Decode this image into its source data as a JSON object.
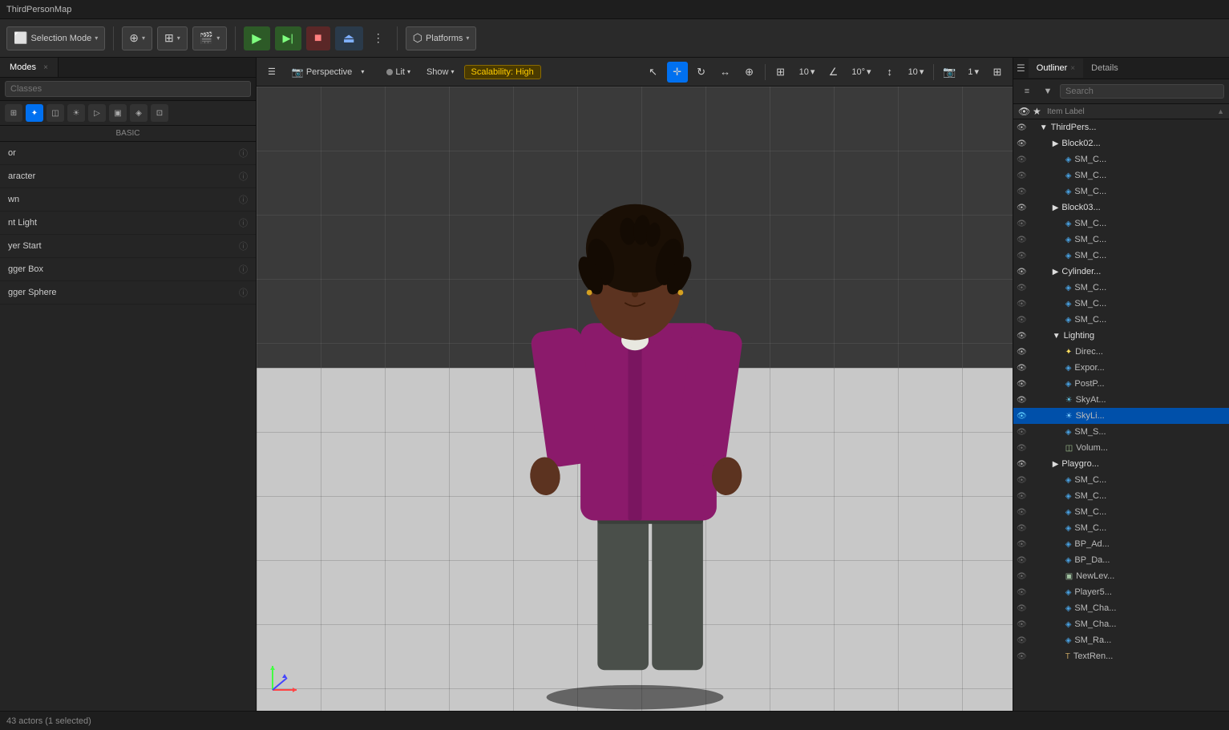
{
  "app": {
    "title": "ThirdPersonMap",
    "window_close": "×"
  },
  "toolbar": {
    "selection_mode_label": "Selection Mode",
    "chevron": "▾",
    "play_icon": "▶",
    "play_from_icon": "▶|",
    "stop_icon": "■",
    "eject_icon": "⏏",
    "more_icon": "⋮",
    "platforms_icon": "⬡",
    "platforms_label": "Platforms"
  },
  "viewport": {
    "menu_icon": "☰",
    "perspective_label": "Perspective",
    "lit_label": "Lit",
    "show_label": "Show",
    "scalability_label": "Scalability: High",
    "camera_icon": "◎",
    "snap_icon": "+",
    "rotate_icon": "↻",
    "scale_icon": "↔",
    "grid_icon": "⊞",
    "grid_value": "10",
    "angle_icon": "∠",
    "angle_value": "10°",
    "scale_value": "10",
    "camera_speed": "1",
    "layout_icon": "⊞"
  },
  "left_panel": {
    "tab_label": "Modes",
    "tab_close": "×",
    "search_placeholder": "Classes",
    "basic_label": "BASIC",
    "items": [
      {
        "name": "Actor",
        "partial": "or"
      },
      {
        "name": "Character",
        "partial": "aracter"
      },
      {
        "name": "Pawn",
        "partial": "wn"
      },
      {
        "name": "Point Light",
        "partial": "nt Light"
      },
      {
        "name": "Player Start",
        "partial": "yer Start"
      },
      {
        "name": "Trigger Box",
        "partial": "gger Box"
      },
      {
        "name": "Trigger Sphere",
        "partial": "gger Sphere"
      }
    ]
  },
  "right_panel": {
    "outliner_tab_label": "Outliner",
    "details_tab_label": "Details",
    "tab_close": "×",
    "search_placeholder": "Search",
    "column_label": "Item Label",
    "items": [
      {
        "indent": 0,
        "type": "folder",
        "name": "ThirdPers...",
        "icon": "▼"
      },
      {
        "indent": 1,
        "type": "folder",
        "name": "Block02...",
        "icon": "▶"
      },
      {
        "indent": 2,
        "type": "mesh",
        "name": "SM_C...",
        "icon": "◈"
      },
      {
        "indent": 2,
        "type": "mesh",
        "name": "SM_C...",
        "icon": "◈"
      },
      {
        "indent": 2,
        "type": "mesh",
        "name": "SM_C...",
        "icon": "◈"
      },
      {
        "indent": 1,
        "type": "folder",
        "name": "Block03...",
        "icon": "▶"
      },
      {
        "indent": 2,
        "type": "mesh",
        "name": "SM_C...",
        "icon": "◈"
      },
      {
        "indent": 2,
        "type": "mesh",
        "name": "SM_C...",
        "icon": "◈"
      },
      {
        "indent": 2,
        "type": "mesh",
        "name": "SM_C...",
        "icon": "◈"
      },
      {
        "indent": 1,
        "type": "folder",
        "name": "Cylinder...",
        "icon": "▶"
      },
      {
        "indent": 2,
        "type": "mesh",
        "name": "SM_C...",
        "icon": "◈"
      },
      {
        "indent": 2,
        "type": "mesh",
        "name": "SM_C...",
        "icon": "◈"
      },
      {
        "indent": 2,
        "type": "mesh",
        "name": "SM_C...",
        "icon": "◈"
      },
      {
        "indent": 1,
        "type": "folder",
        "name": "Lighting",
        "icon": "▼"
      },
      {
        "indent": 2,
        "type": "light",
        "name": "Direc...",
        "icon": "✦"
      },
      {
        "indent": 2,
        "type": "mesh",
        "name": "Expor...",
        "icon": "◈"
      },
      {
        "indent": 2,
        "type": "mesh",
        "name": "PostP...",
        "icon": "◈"
      },
      {
        "indent": 2,
        "type": "light",
        "name": "SkyAt...",
        "icon": "☀"
      },
      {
        "indent": 2,
        "type": "light",
        "name": "SkyLi...",
        "icon": "☀",
        "selected": true
      },
      {
        "indent": 2,
        "type": "mesh",
        "name": "SM_S...",
        "icon": "◈"
      },
      {
        "indent": 2,
        "type": "volume",
        "name": "Volum...",
        "icon": "◫"
      },
      {
        "indent": 1,
        "type": "folder",
        "name": "Playgro...",
        "icon": "▶"
      },
      {
        "indent": 2,
        "type": "mesh",
        "name": "SM_C...",
        "icon": "◈"
      },
      {
        "indent": 2,
        "type": "mesh",
        "name": "SM_C...",
        "icon": "◈"
      },
      {
        "indent": 2,
        "type": "mesh",
        "name": "SM_C...",
        "icon": "◈"
      },
      {
        "indent": 2,
        "type": "mesh",
        "name": "SM_C...",
        "icon": "◈"
      },
      {
        "indent": 2,
        "type": "mesh",
        "name": "BP_Ad...",
        "icon": "◈"
      },
      {
        "indent": 2,
        "type": "mesh",
        "name": "BP_Da...",
        "icon": "◈"
      },
      {
        "indent": 2,
        "type": "mesh",
        "name": "NewLev...",
        "icon": "◈"
      },
      {
        "indent": 2,
        "type": "mesh",
        "name": "Player5...",
        "icon": "◈"
      },
      {
        "indent": 2,
        "type": "mesh",
        "name": "SM_Cha...",
        "icon": "◈"
      },
      {
        "indent": 2,
        "type": "mesh",
        "name": "SM_Cha...",
        "icon": "◈"
      },
      {
        "indent": 2,
        "type": "mesh",
        "name": "SM_Ra...",
        "icon": "◈"
      },
      {
        "indent": 2,
        "type": "text",
        "name": "TextRen...",
        "icon": "T"
      }
    ]
  },
  "status_bar": {
    "text": "43 actors (1 selected)"
  }
}
